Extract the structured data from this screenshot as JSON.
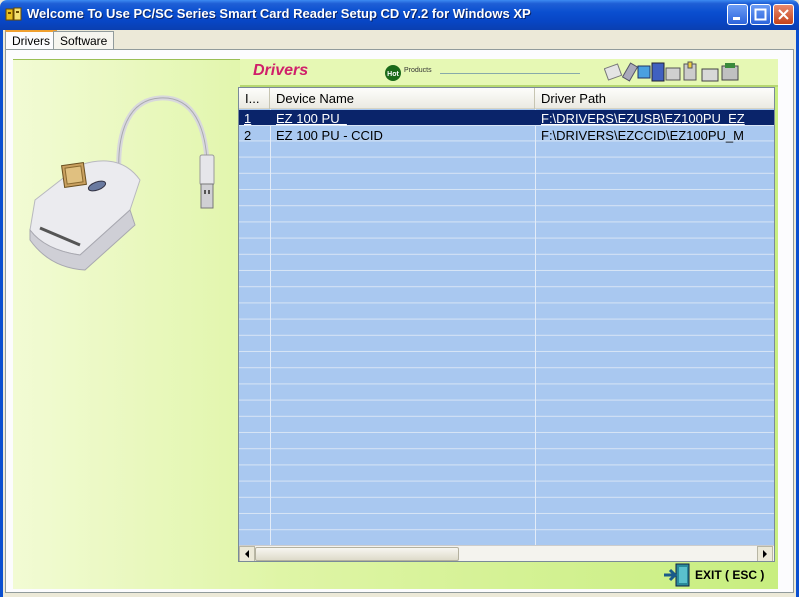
{
  "window": {
    "title": "Welcome To Use PC/SC Series Smart Card Reader Setup CD v7.2 for Windows XP"
  },
  "tabs": [
    {
      "label": "Drivers",
      "active": true
    },
    {
      "label": "Software",
      "active": false
    }
  ],
  "banner": {
    "title": "Drivers",
    "hot_badge": "Hot",
    "hot_label": "Products"
  },
  "list": {
    "columns": [
      "I...",
      "Device Name",
      "Driver Path"
    ],
    "rows": [
      {
        "index": "1",
        "device": "EZ 100 PU_",
        "path": "F:\\DRIVERS\\EZUSB\\EZ100PU_EZ",
        "selected": true
      },
      {
        "index": "2",
        "device": "EZ 100 PU - CCID",
        "path": "F:\\DRIVERS\\EZCCID\\EZ100PU_M",
        "selected": false
      }
    ]
  },
  "exit": {
    "label": "EXIT ( ESC )"
  },
  "colors": {
    "title_bar": "#0a4fd0",
    "selection": "#0a246a",
    "list_background": "#a9c8f0",
    "drivers_title": "#d0206a",
    "content_green": "#c8ee80"
  }
}
